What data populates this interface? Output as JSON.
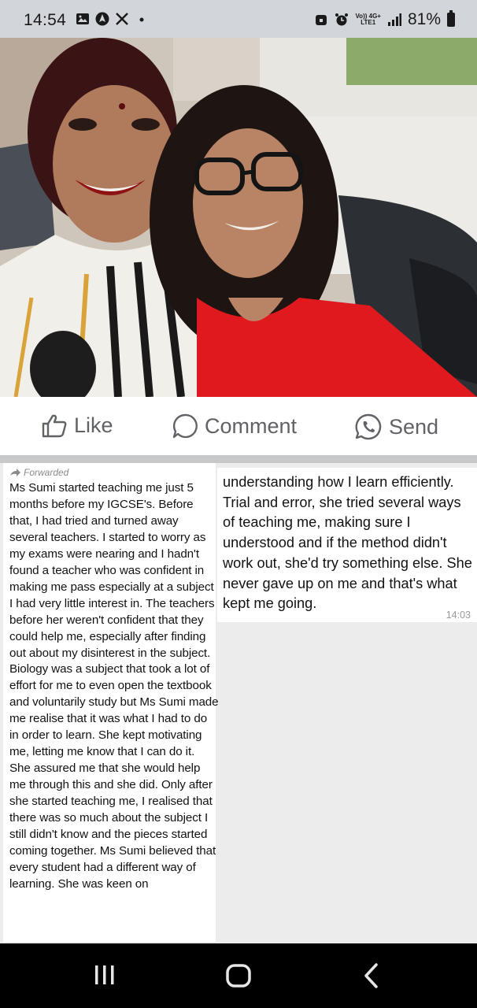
{
  "status_bar": {
    "time": "14:54",
    "network_top": "Vo)) 4G+",
    "network_bottom": "LTE1",
    "battery": "81%"
  },
  "actions": {
    "like": "Like",
    "comment": "Comment",
    "send": "Send"
  },
  "message_left": {
    "forwarded_label": "Forwarded",
    "text": "Ms Sumi started teaching me just 5 months before my IGCSE's. Before that, I had tried and turned away several teachers. I started to worry as my exams were nearing and I hadn't found a teacher who was confident in making me pass especially at a subject I had very little interest in. The teachers before her weren't confident that they could help me, especially after finding out about my disinterest in the subject. Biology was a subject that took a lot of effort for me to even open the textbook and voluntarily study but Ms Sumi made me realise that it was what I had to do in order to learn. She kept motivating me, letting me know that I can do it. She assured me that she would help me through this and she did. Only after she started teaching me, I realised that there was so much about the subject I still didn't know and the pieces started coming together. Ms Sumi believed that every student had a different way of learning. She was keen on"
  },
  "message_right": {
    "text": "understanding how I learn efficiently. Trial and error, she tried several ways of teaching me, making sure I understood and if the method didn't work out, she'd try something else. She never gave up on me and that's what kept me going.",
    "time": "14:03"
  },
  "colors": {
    "action_text": "#606266",
    "chat_background": "#ececec",
    "status_bar": "#d2d5d9"
  }
}
